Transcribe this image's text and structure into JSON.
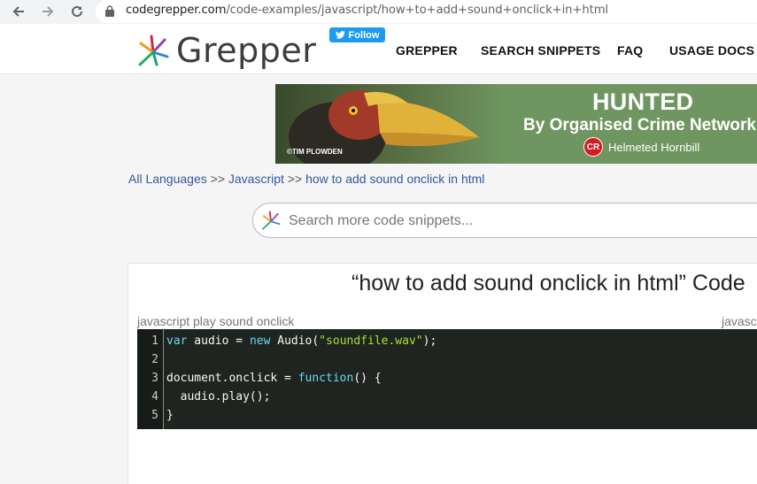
{
  "browser": {
    "url_host": "codegrepper.com",
    "url_path": "/code-examples/javascript/how+to+add+sound+onclick+in+html"
  },
  "header": {
    "logo_text": "Grepper",
    "follow_label": "Follow",
    "nav": [
      "GREPPER",
      "SEARCH SNIPPETS",
      "FAQ",
      "USAGE DOCS"
    ]
  },
  "ad": {
    "credit": "©TIM PLOWDEN",
    "headline": "HUNTED",
    "subheadline": "By Organised Crime Network",
    "badge": "CR",
    "species": "Helmeted Hornbill"
  },
  "breadcrumb": {
    "items": [
      "All Languages",
      "Javascript",
      "how to add sound onclick in html"
    ],
    "separator": ">>"
  },
  "search": {
    "placeholder": "Search more code snippets..."
  },
  "main": {
    "title": "“how to add sound onclick in html” Code",
    "snippet": {
      "title": "javascript play sound onclick",
      "language": "javasc",
      "line_numbers": [
        "1",
        "2",
        "3",
        "4",
        "5"
      ],
      "lines": [
        [
          {
            "t": "kw",
            "v": "var"
          },
          {
            "t": "",
            "v": " audio = "
          },
          {
            "t": "kw",
            "v": "new"
          },
          {
            "t": "",
            "v": " Audio("
          },
          {
            "t": "str",
            "v": "\"soundfile.wav\""
          },
          {
            "t": "",
            "v": ");"
          }
        ],
        [],
        [
          {
            "t": "",
            "v": "document.onclick = "
          },
          {
            "t": "kw",
            "v": "function"
          },
          {
            "t": "",
            "v": "() {"
          }
        ],
        [
          {
            "t": "",
            "v": "  audio.play();"
          }
        ],
        [
          {
            "t": "",
            "v": "}"
          }
        ]
      ]
    }
  },
  "colors": {
    "code_bg": "#1f2420",
    "keyword": "#66d9ef",
    "string": "#a6e22e",
    "link": "#34589e",
    "twitter": "#1d9bf0"
  }
}
